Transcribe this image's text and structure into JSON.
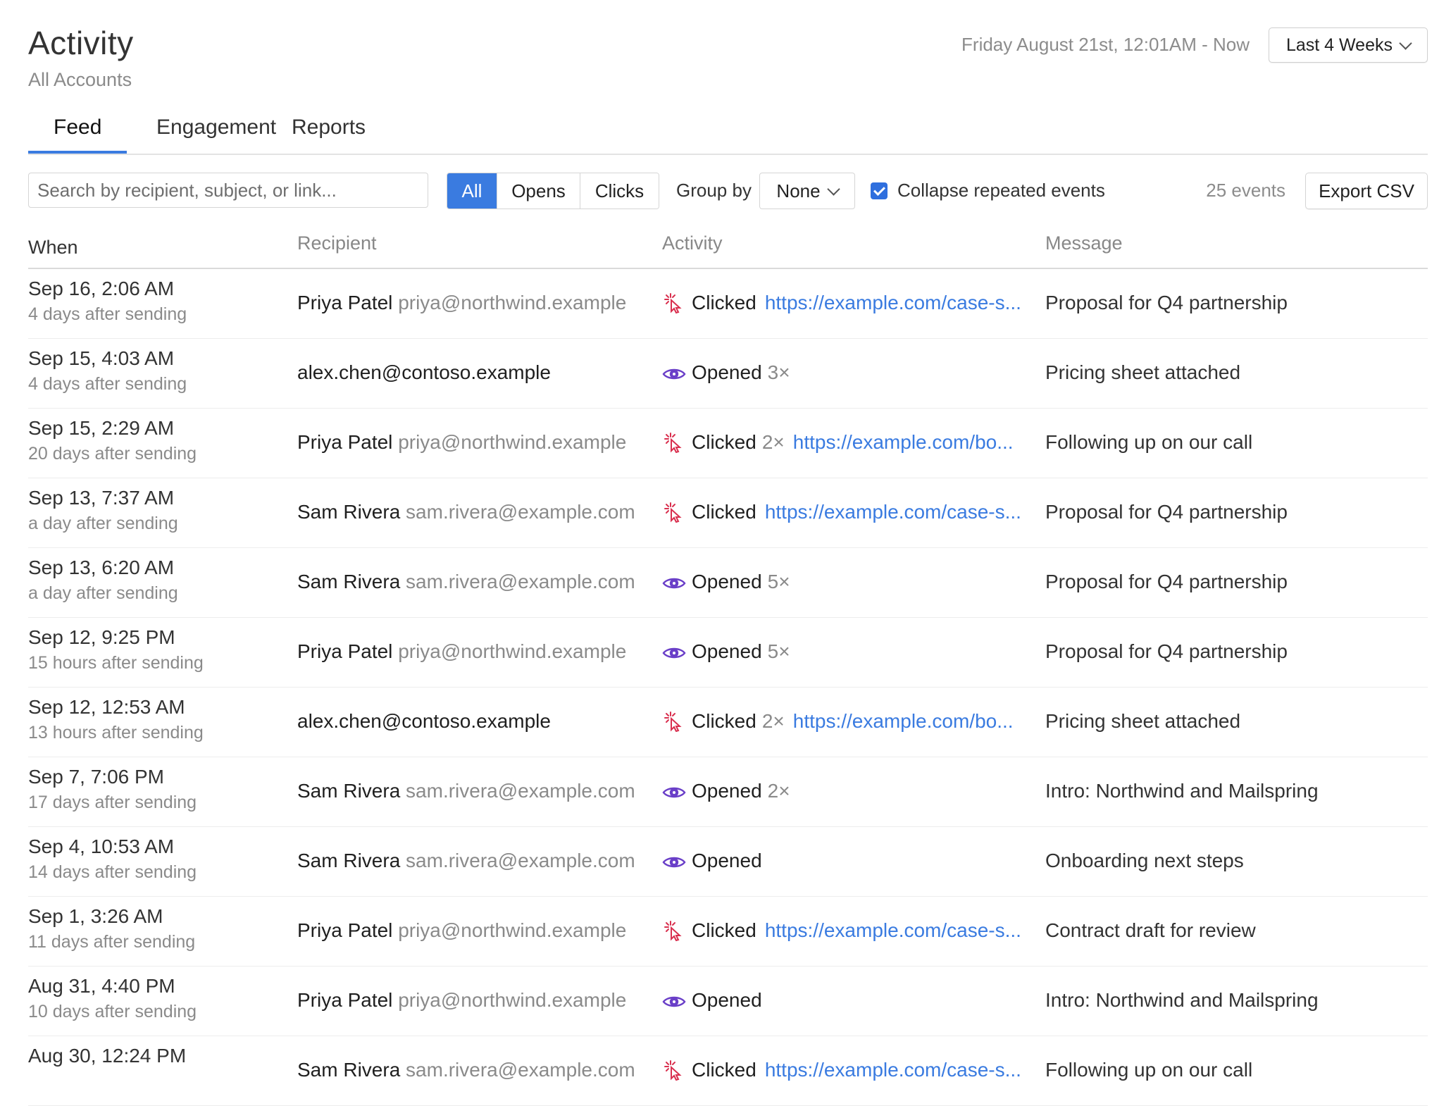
{
  "header": {
    "title": "Activity",
    "subtitle": "All Accounts",
    "date_range": "Friday August 21st, 12:01AM - Now",
    "range_button": "Last 4 Weeks"
  },
  "tabs": [
    {
      "label": "Feed",
      "active": true
    },
    {
      "label": "Engagement",
      "active": false
    },
    {
      "label": "Reports",
      "active": false
    }
  ],
  "toolbar": {
    "search_placeholder": "Search by recipient, subject, or link...",
    "filters": [
      {
        "label": "All",
        "active": true
      },
      {
        "label": "Opens",
        "active": false
      },
      {
        "label": "Clicks",
        "active": false
      }
    ],
    "group_by_label": "Group by",
    "group_by_value": "None",
    "collapse_checked": true,
    "collapse_label": "Collapse repeated events",
    "event_count": "25 events",
    "export_label": "Export CSV"
  },
  "columns": {
    "when": "When",
    "recipient": "Recipient",
    "activity": "Activity",
    "message": "Message"
  },
  "colors": {
    "accent": "#3a7be0",
    "click_icon": "#d9304f",
    "open_icon": "#6a3fc8"
  },
  "rows": [
    {
      "when": "Sep 16, 2:06 AM",
      "after": "4 days after sending",
      "name": "Priya Patel",
      "email": "priya@northwind.example",
      "type": "click",
      "verb": "Clicked",
      "count": "",
      "link": "https://example.com/case-s...",
      "message": "Proposal for Q4 partnership"
    },
    {
      "when": "Sep 15, 4:03 AM",
      "after": "4 days after sending",
      "name": "",
      "email": "alex.chen@contoso.example",
      "type": "open",
      "verb": "Opened",
      "count": "3×",
      "link": "",
      "message": "Pricing sheet attached"
    },
    {
      "when": "Sep 15, 2:29 AM",
      "after": "20 days after sending",
      "name": "Priya Patel",
      "email": "priya@northwind.example",
      "type": "click",
      "verb": "Clicked",
      "count": "2×",
      "link": "https://example.com/bo...",
      "message": "Following up on our call"
    },
    {
      "when": "Sep 13, 7:37 AM",
      "after": "a day after sending",
      "name": "Sam Rivera",
      "email": "sam.rivera@example.com",
      "type": "click",
      "verb": "Clicked",
      "count": "",
      "link": "https://example.com/case-s...",
      "message": "Proposal for Q4 partnership"
    },
    {
      "when": "Sep 13, 6:20 AM",
      "after": "a day after sending",
      "name": "Sam Rivera",
      "email": "sam.rivera@example.com",
      "type": "open",
      "verb": "Opened",
      "count": "5×",
      "link": "",
      "message": "Proposal for Q4 partnership"
    },
    {
      "when": "Sep 12, 9:25 PM",
      "after": "15 hours after sending",
      "name": "Priya Patel",
      "email": "priya@northwind.example",
      "type": "open",
      "verb": "Opened",
      "count": "5×",
      "link": "",
      "message": "Proposal for Q4 partnership"
    },
    {
      "when": "Sep 12, 12:53 AM",
      "after": "13 hours after sending",
      "name": "",
      "email": "alex.chen@contoso.example",
      "type": "click",
      "verb": "Clicked",
      "count": "2×",
      "link": "https://example.com/bo...",
      "message": "Pricing sheet attached"
    },
    {
      "when": "Sep 7, 7:06 PM",
      "after": "17 days after sending",
      "name": "Sam Rivera",
      "email": "sam.rivera@example.com",
      "type": "open",
      "verb": "Opened",
      "count": "2×",
      "link": "",
      "message": "Intro: Northwind and Mailspring"
    },
    {
      "when": "Sep 4, 10:53 AM",
      "after": "14 days after sending",
      "name": "Sam Rivera",
      "email": "sam.rivera@example.com",
      "type": "open",
      "verb": "Opened",
      "count": "",
      "link": "",
      "message": "Onboarding next steps"
    },
    {
      "when": "Sep 1, 3:26 AM",
      "after": "11 days after sending",
      "name": "Priya Patel",
      "email": "priya@northwind.example",
      "type": "click",
      "verb": "Clicked",
      "count": "",
      "link": "https://example.com/case-s...",
      "message": "Contract draft for review"
    },
    {
      "when": "Aug 31, 4:40 PM",
      "after": "10 days after sending",
      "name": "Priya Patel",
      "email": "priya@northwind.example",
      "type": "open",
      "verb": "Opened",
      "count": "",
      "link": "",
      "message": "Intro: Northwind and Mailspring"
    },
    {
      "when": "Aug 30, 12:24 PM",
      "after": "",
      "name": "Sam Rivera",
      "email": "sam.rivera@example.com",
      "type": "click",
      "verb": "Clicked",
      "count": "",
      "link": "https://example.com/case-s...",
      "message": "Following up on our call"
    }
  ]
}
